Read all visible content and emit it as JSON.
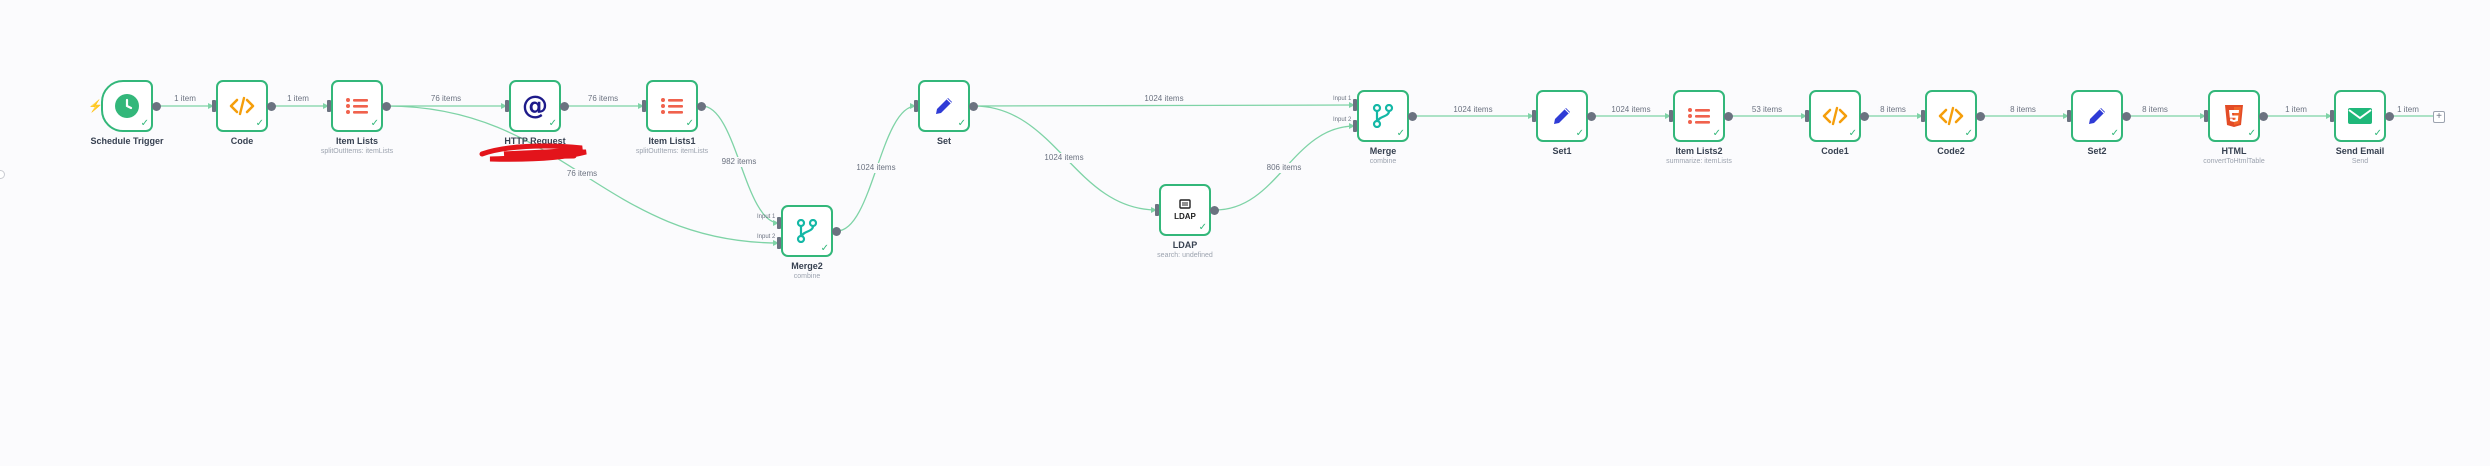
{
  "workflow": {
    "nodes": [
      {
        "key": "trigger",
        "title": "Schedule Trigger",
        "subtitle": "",
        "icon": "clock-icon",
        "color": "#33b77a"
      },
      {
        "key": "code",
        "title": "Code",
        "subtitle": "",
        "icon": "code-icon",
        "color": "#f59e0b"
      },
      {
        "key": "itemlists",
        "title": "Item Lists",
        "subtitle": "splitOutItems: itemLists",
        "icon": "list-icon",
        "color": "#f0624d"
      },
      {
        "key": "http",
        "title": "HTTP Request",
        "subtitle": "",
        "icon": "at-icon",
        "color": "#1e1b8a"
      },
      {
        "key": "itemlists1",
        "title": "Item Lists1",
        "subtitle": "splitOutItems: itemLists",
        "icon": "list-icon",
        "color": "#f0624d"
      },
      {
        "key": "merge2",
        "title": "Merge2",
        "subtitle": "combine",
        "icon": "merge-icon",
        "color": "#14b8a6"
      },
      {
        "key": "set",
        "title": "Set",
        "subtitle": "",
        "icon": "pen-icon",
        "color": "#2f3bd6"
      },
      {
        "key": "ldap",
        "title": "LDAP",
        "subtitle": "search: undefined",
        "icon": "ldap-icon",
        "color": "#222222"
      },
      {
        "key": "merge",
        "title": "Merge",
        "subtitle": "combine",
        "icon": "merge-icon",
        "color": "#14b8a6"
      },
      {
        "key": "set1",
        "title": "Set1",
        "subtitle": "",
        "icon": "pen-icon",
        "color": "#2f3bd6"
      },
      {
        "key": "itemlists2",
        "title": "Item Lists2",
        "subtitle": "summarize: itemLists",
        "icon": "list-icon",
        "color": "#f0624d"
      },
      {
        "key": "code1",
        "title": "Code1",
        "subtitle": "",
        "icon": "code-icon",
        "color": "#f59e0b"
      },
      {
        "key": "code2",
        "title": "Code2",
        "subtitle": "",
        "icon": "code-icon",
        "color": "#f59e0b"
      },
      {
        "key": "set2",
        "title": "Set2",
        "subtitle": "",
        "icon": "pen-icon",
        "color": "#2f3bd6"
      },
      {
        "key": "html",
        "title": "HTML",
        "subtitle": "convertToHtmlTable",
        "icon": "html5-icon",
        "color": "#e34c26"
      },
      {
        "key": "email",
        "title": "Send Email",
        "subtitle": "Send",
        "icon": "mail-icon",
        "color": "#1fb87a"
      }
    ],
    "edges": [
      {
        "key": "trigger-code",
        "label": "1 item"
      },
      {
        "key": "code-itemlists",
        "label": "1 item"
      },
      {
        "key": "itemlists-http",
        "label": "76 items"
      },
      {
        "key": "itemlists-merge2",
        "label": "76 items"
      },
      {
        "key": "http-itemlists1",
        "label": "76 items"
      },
      {
        "key": "itemlists1-merge2",
        "label": "982 items"
      },
      {
        "key": "merge2-set",
        "label": "1024 items"
      },
      {
        "key": "set-merge",
        "label": "1024 items"
      },
      {
        "key": "set-ldap",
        "label": "1024 items"
      },
      {
        "key": "ldap-merge",
        "label": "806 items"
      },
      {
        "key": "merge-set1",
        "label": "1024 items"
      },
      {
        "key": "set1-itemlists2",
        "label": "1024 items"
      },
      {
        "key": "itemlists2-code1",
        "label": "53 items"
      },
      {
        "key": "code1-code2",
        "label": "8 items"
      },
      {
        "key": "code2-set2",
        "label": "8 items"
      },
      {
        "key": "set2-html",
        "label": "8 items"
      },
      {
        "key": "html-email",
        "label": "1 item"
      },
      {
        "key": "email-end",
        "label": "1 item"
      }
    ],
    "inputs": {
      "input1": "Input 1",
      "input2": "Input 2"
    },
    "check_glyph": "✓",
    "add_glyph": "+"
  }
}
